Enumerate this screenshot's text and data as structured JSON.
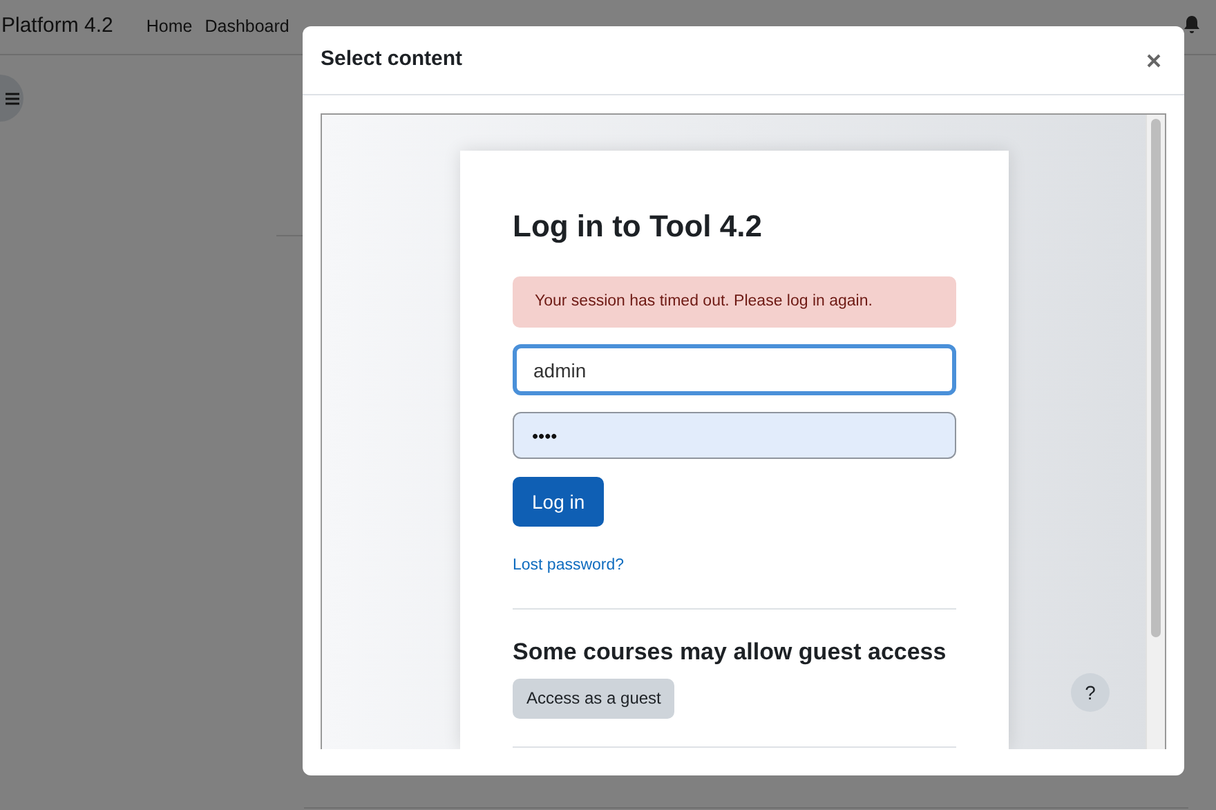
{
  "background_page": {
    "site_name": "Platform 4.2",
    "nav_items": [
      {
        "label": "Home"
      },
      {
        "label": "Dashboard"
      }
    ]
  },
  "modal": {
    "title": "Select content",
    "login": {
      "title": "Log in to Tool 4.2",
      "alert": "Your session has timed out. Please log in again.",
      "username": {
        "value": "admin",
        "focused": true
      },
      "password": {
        "value": "••••",
        "autofilled": true
      },
      "login_button": "Log in",
      "lost_password_link": "Lost password?",
      "guest_heading": "Some courses may allow guest access",
      "guest_button": "Access as a guest"
    },
    "help_button": "?"
  }
}
